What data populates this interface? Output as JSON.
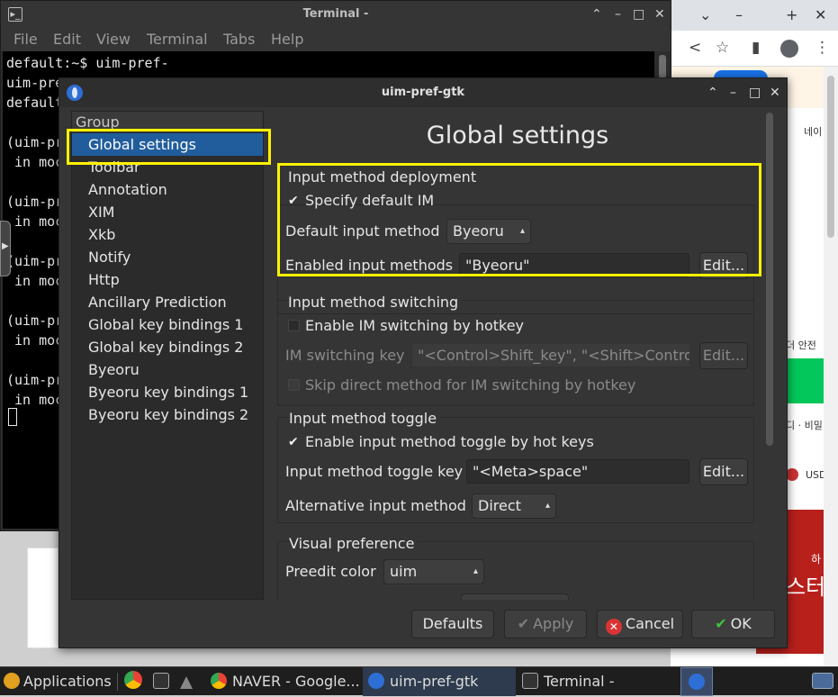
{
  "browser": {
    "side_texts": [
      "네이",
      "더 안전",
      "디 · 비밀",
      "USD",
      "하",
      "스터"
    ]
  },
  "terminal": {
    "title": "Terminal -",
    "menu": [
      "File",
      "Edit",
      "View",
      "Terminal",
      "Tabs",
      "Help"
    ],
    "lines": [
      "default:~$ uim-pref-",
      "uim-pre",
      "default",
      "",
      "(uim-pre",
      " in moc",
      "",
      "(uim-pre",
      " in moc",
      "",
      "(uim-pre",
      " in moc",
      "",
      "(uim-pre",
      " in moc",
      "",
      "(uim-pre",
      " in moc"
    ]
  },
  "dialog": {
    "title": "uim-pref-gtk",
    "sidebar": {
      "header": "Group",
      "items": [
        "Global settings",
        "Toolbar",
        "Annotation",
        "XIM",
        "Xkb",
        "Notify",
        "Http",
        "Ancillary Prediction",
        "Global key bindings 1",
        "Global key bindings 2",
        "Byeoru",
        "Byeoru key bindings 1",
        "Byeoru key bindings 2"
      ],
      "selected_index": 0
    },
    "content": {
      "heading": "Global settings",
      "deployment": {
        "title": "Input method deployment",
        "specify_default_label": "Specify default IM",
        "specify_default_checked": true,
        "default_im_label": "Default input method",
        "default_im_value": "Byeoru",
        "enabled_label": "Enabled input methods",
        "enabled_value": "\"Byeoru\"",
        "edit_label": "Edit..."
      },
      "switching": {
        "title": "Input method switching",
        "enable_label": "Enable IM switching by hotkey",
        "enable_checked": false,
        "key_label": "IM switching key",
        "key_value": "\"<Control>Shift_key\", \"<Shift>Control",
        "edit_label": "Edit...",
        "skip_label": "Skip direct method for IM switching by hotkey"
      },
      "toggle": {
        "title": "Input method toggle",
        "enable_label": "Enable input method toggle by hot keys",
        "enable_checked": true,
        "key_label": "Input method toggle key",
        "key_value": "\"<Meta>space\"",
        "edit_label": "Edit...",
        "alt_label": "Alternative input method",
        "alt_value": "Direct"
      },
      "visual": {
        "title": "Visual preference",
        "preedit_label": "Preedit color",
        "preedit_value": "uim"
      }
    },
    "buttons": {
      "defaults": "Defaults",
      "apply": "Apply",
      "cancel": "Cancel",
      "ok": "OK"
    },
    "highlight_color": "#fff200"
  },
  "taskbar": {
    "applications": "Applications",
    "naver": "NAVER - Google...",
    "uim": "uim-pref-gtk",
    "terminal": "Terminal -"
  }
}
